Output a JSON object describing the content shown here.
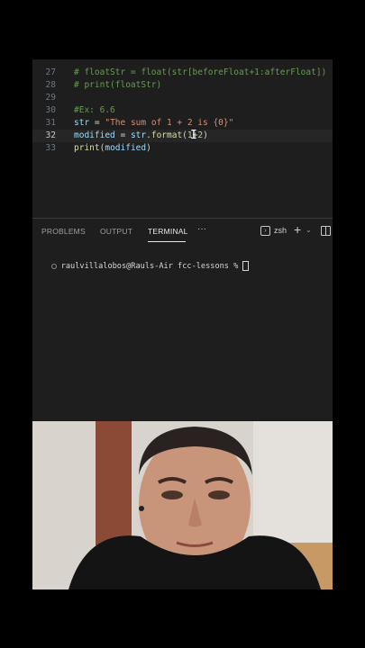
{
  "editor": {
    "lines": [
      {
        "num": "27",
        "active": false,
        "tokens": [
          {
            "t": "# floatStr = float(str[beforeFloat+1:afterFloat])",
            "c": "cm"
          }
        ]
      },
      {
        "num": "28",
        "active": false,
        "tokens": [
          {
            "t": "# print(floatStr)",
            "c": "cm"
          }
        ]
      },
      {
        "num": "29",
        "active": false,
        "tokens": []
      },
      {
        "num": "30",
        "active": false,
        "tokens": [
          {
            "t": "#Ex: 6.6",
            "c": "cm"
          }
        ]
      },
      {
        "num": "31",
        "active": false,
        "tokens": [
          {
            "t": "str",
            "c": "var"
          },
          {
            "t": " = ",
            "c": "op"
          },
          {
            "t": "\"The sum of 1 + 2 is {0}\"",
            "c": "str"
          }
        ]
      },
      {
        "num": "32",
        "active": true,
        "tokens": [
          {
            "t": "modified",
            "c": "var"
          },
          {
            "t": " = ",
            "c": "op"
          },
          {
            "t": "str",
            "c": "var"
          },
          {
            "t": ".",
            "c": "op"
          },
          {
            "t": "format",
            "c": "fn"
          },
          {
            "t": "(",
            "c": "op"
          },
          {
            "t": "1",
            "c": "num"
          },
          {
            "t": "+",
            "c": "op"
          },
          {
            "t": "2",
            "c": "num"
          },
          {
            "t": ")",
            "c": "op"
          }
        ]
      },
      {
        "num": "33",
        "active": false,
        "tokens": [
          {
            "t": "print",
            "c": "fn"
          },
          {
            "t": "(",
            "c": "op"
          },
          {
            "t": "modified",
            "c": "var"
          },
          {
            "t": ")",
            "c": "op"
          }
        ]
      }
    ]
  },
  "panel": {
    "tabs": [
      "PROBLEMS",
      "OUTPUT",
      "TERMINAL"
    ],
    "more": "···",
    "terminal_name": "zsh",
    "plus": "+",
    "chevron": "⌄"
  },
  "terminal": {
    "prompt": "raulvillalobos@Rauls-Air fcc-lessons % "
  },
  "colors": {
    "editor_bg": "#1e1e1e",
    "comment": "#6a9955",
    "string": "#ce9178",
    "variable": "#9cdcfe",
    "function": "#dcdcaa",
    "number": "#b5cea8"
  }
}
